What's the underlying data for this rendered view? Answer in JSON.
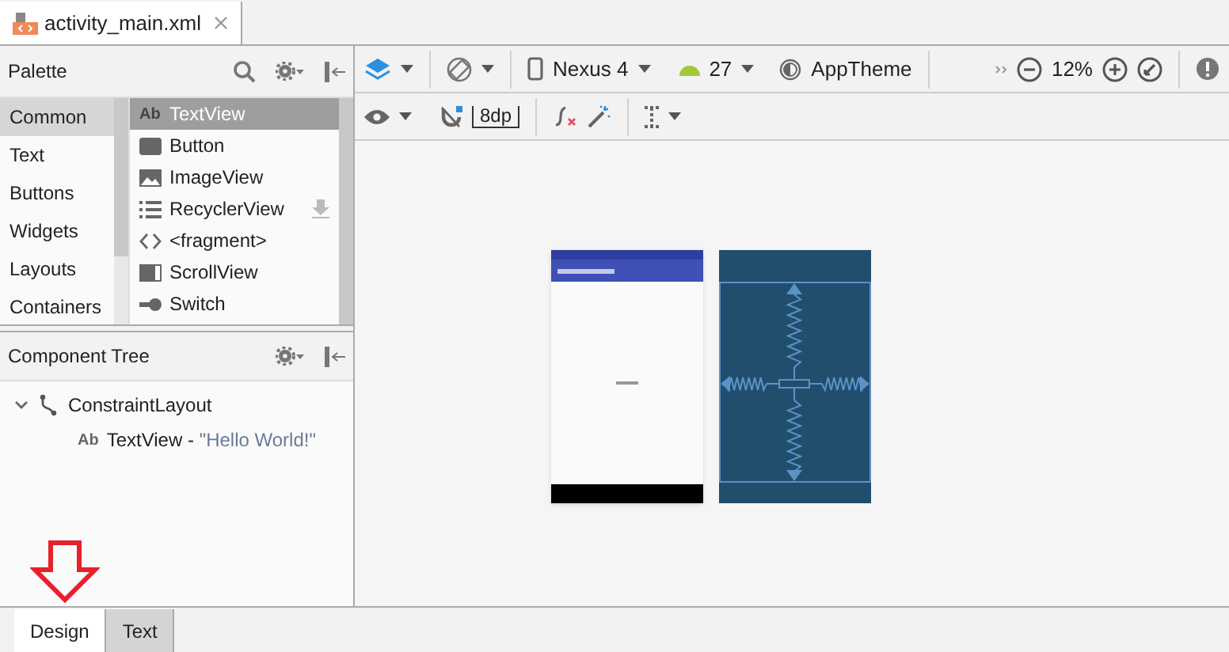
{
  "file_tabs": [
    {
      "label": "activity_main.xml",
      "selected": true
    }
  ],
  "palette": {
    "title": "Palette",
    "categories": [
      {
        "label": "Common",
        "selected": true
      },
      {
        "label": "Text",
        "selected": false
      },
      {
        "label": "Buttons",
        "selected": false
      },
      {
        "label": "Widgets",
        "selected": false
      },
      {
        "label": "Layouts",
        "selected": false
      },
      {
        "label": "Containers",
        "selected": false
      }
    ],
    "items": [
      {
        "badge": "Ab",
        "label": "TextView",
        "selected": true,
        "downloadable": false
      },
      {
        "label": "Button",
        "selected": false,
        "downloadable": false
      },
      {
        "label": "ImageView",
        "selected": false,
        "downloadable": false
      },
      {
        "label": "RecyclerView",
        "selected": false,
        "downloadable": true
      },
      {
        "label": "<fragment>",
        "selected": false,
        "downloadable": false
      },
      {
        "label": "ScrollView",
        "selected": false,
        "downloadable": false
      },
      {
        "label": "Switch",
        "selected": false,
        "downloadable": false
      }
    ]
  },
  "component_tree": {
    "title": "Component Tree",
    "nodes": [
      {
        "label": "ConstraintLayout",
        "expanded": true,
        "children": [
          {
            "badge": "Ab",
            "label": "TextView",
            "separator": " - ",
            "value": "\"Hello World!\""
          }
        ]
      }
    ]
  },
  "toolbar": {
    "device": "Nexus 4",
    "api": "27",
    "theme": "AppTheme",
    "zoom": "12%",
    "margin": "8dp"
  },
  "bottom_tabs": [
    {
      "label": "Design",
      "selected": true
    },
    {
      "label": "Text",
      "selected": false
    }
  ]
}
